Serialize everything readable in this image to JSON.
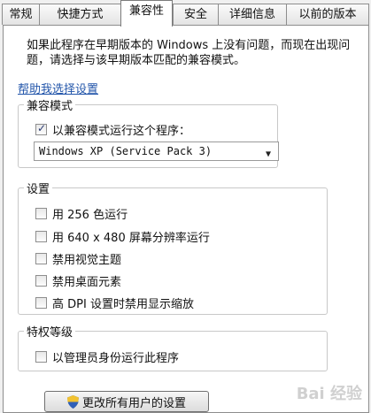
{
  "tabs": [
    {
      "label": "常规"
    },
    {
      "label": "快捷方式"
    },
    {
      "label": "兼容性"
    },
    {
      "label": "安全"
    },
    {
      "label": "详细信息"
    },
    {
      "label": "以前的版本"
    }
  ],
  "description": "如果此程序在早期版本的 Windows 上没有问题，而现在出现问题，请选择与该早期版本匹配的兼容模式。",
  "help_link": "帮助我选择设置",
  "compat_mode": {
    "legend": "兼容模式",
    "checkbox_label": "以兼容模式运行这个程序：",
    "checked": true,
    "selected_os": "Windows XP (Service Pack 3)"
  },
  "settings": {
    "legend": "设置",
    "items": [
      {
        "label": "用 256 色运行",
        "checked": false
      },
      {
        "label": "用 640 x 480 屏幕分辨率运行",
        "checked": false
      },
      {
        "label": "禁用视觉主题",
        "checked": false
      },
      {
        "label": "禁用桌面元素",
        "checked": false
      },
      {
        "label": "高 DPI 设置时禁用显示缩放",
        "checked": false
      }
    ]
  },
  "privilege": {
    "legend": "特权等级",
    "checkbox_label": "以管理员身份运行此程序",
    "checked": false
  },
  "all_users_button": "更改所有用户的设置",
  "watermark": "Bai 经验"
}
